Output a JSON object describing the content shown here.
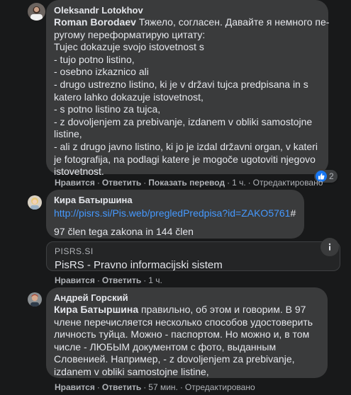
{
  "comments": [
    {
      "author": "Oleksandr Lotokhov",
      "mention": "Roman Borodaev",
      "first_line_rest": " Тяжело, согласен. Давайте я немного пе-",
      "lines": [
        "ругому переформатирую цитату:",
        "Tujec dokazuje svojo istovetnost s",
        "- tujo potno listino,",
        "- osebno izkaznico ali",
        "- drugo ustrezno listino, ki je v državi tujca predpisana in s",
        "katero lahko dokazuje istovetnost,",
        "- s potno listino za tujca,",
        "- z dovoljenjem za prebivanje, izdanem v obliki samostojne",
        "listine,",
        "- ali z drugo javno listino, ki jo je izdal državni organ, v kateri",
        "je fotografija, na podlagi katere je mogoče ugotoviti njegovo",
        "istovetnost."
      ],
      "actions": {
        "like": "Нравится",
        "reply": "Ответить",
        "translate": "Показать перевод",
        "time": "1 ч.",
        "edited": "Отредактировано"
      },
      "reaction_count": "2"
    },
    {
      "author": "Кира Батыршина",
      "link": "http://pisrs.si/Pis.web/pregledPredpisa?id=ZAKO5761",
      "link_suffix": "#",
      "line2": "97 člen tega zakona in 144 člen",
      "preview": {
        "domain": "PISRS.SI",
        "title": "PisRS - Pravno informacijski sistem"
      },
      "actions": {
        "like": "Нравится",
        "reply": "Ответить",
        "time": "1 ч."
      }
    },
    {
      "author": "Андрей Горский",
      "mention": "Кира Батыршина",
      "first_line_rest": " правильно, об этом и говорим. В 97",
      "lines": [
        "члене перечисляется несколько способов удостоверить",
        "личность туйца. Можно - паспортом. Но можно и, в том",
        "числе - ЛЮБЫМ документом с фото, выданным",
        "Словенией. Например, - z dovoljenjem za prebivanje,",
        "izdanem v obliki samostojne listine,"
      ],
      "actions": {
        "like": "Нравится",
        "reply": "Ответить",
        "time": "57 мин.",
        "edited": "Отредактировано"
      }
    }
  ],
  "colors": {
    "background": "#18191a",
    "bubble": "#3a3b3c",
    "link": "#4599ff",
    "like_blue": "#1877f2",
    "meta_text": "#b0b3b8"
  },
  "icons": {
    "like": "thumbs-up-icon",
    "info": "info-icon"
  }
}
